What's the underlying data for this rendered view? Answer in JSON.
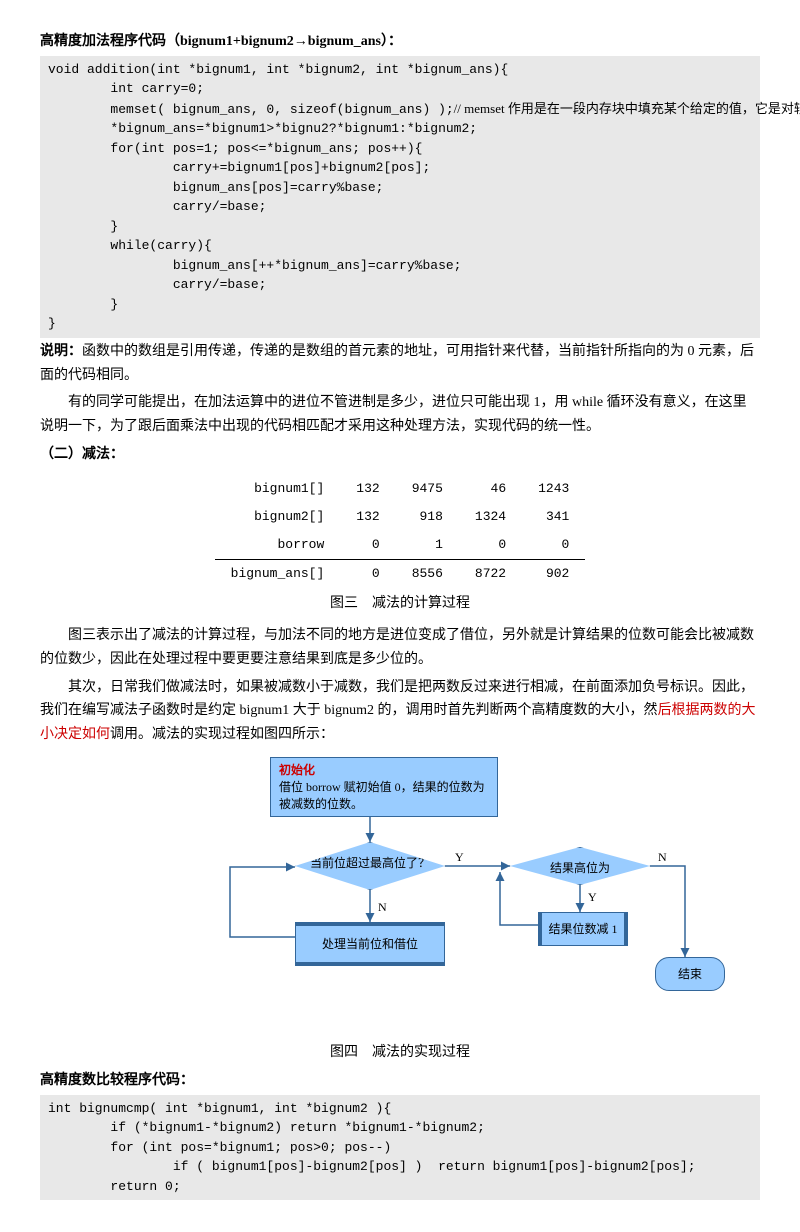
{
  "h1": "高精度加法程序代码（bignum1+bignum2→bignum_ans）：",
  "code1_l1": "void addition(int *bignum1, int *bignum2, int *bignum_ans){",
  "code1_l2": "        int carry=0;",
  "code1_l3": "        memset( bignum_ans, 0, sizeof(bignum_ans) );",
  "code1_l3_cmt": "// memset 作用是在一段内存块中填充某个给定的值，它是对较大的结构体或数组进行清零操作的一种最快方法。",
  "code1_l4": "        *bignum_ans=*bignum1>*bignu2?*bignum1:*bignum2;",
  "code1_l5": "        for(int pos=1; pos<=*bignum_ans; pos++){",
  "code1_l6": "                carry+=bignum1[pos]+bignum2[pos];",
  "code1_l7": "                bignum_ans[pos]=carry%base;",
  "code1_l8": "                carry/=base;",
  "code1_l9": "        }",
  "code1_l10": "        while(carry){",
  "code1_l11": "                bignum_ans[++*bignum_ans]=carry%base;",
  "code1_l12": "                carry/=base;",
  "code1_l13": "        }",
  "code1_l14": "}",
  "note_lbl": "说明：",
  "note_txt": "函数中的数组是引用传递，传递的是数组的首元素的地址，可用指针来代替，当前指针所指向的为 0 元素，后面的代码相同。",
  "p1": "有的同学可能提出，在加法运算中的进位不管进制是多少，进位只可能出现 1，用 while 循环没有意义，在这里说明一下，为了跟后面乘法中出现的代码相匹配才采用这种处理方法，实现代码的统一性。",
  "h2": "（二）减法：",
  "tbl": {
    "r1": [
      "bignum1[]",
      "132",
      "9475",
      "46",
      "1243"
    ],
    "r2": [
      "bignum2[]",
      "132",
      "918",
      "1324",
      "341"
    ],
    "r3": [
      "borrow",
      "0",
      "1",
      "0",
      "0"
    ],
    "r4": [
      "bignum_ans[]",
      "0",
      "8556",
      "8722",
      "902"
    ]
  },
  "cap3": "图三　减法的计算过程",
  "p2": "图三表示出了减法的计算过程，与加法不同的地方是进位变成了借位，另外就是计算结果的位数可能会比被减数的位数少，因此在处理过程中要更要注意结果到底是多少位的。",
  "p3a": "其次，日常我们做减法时，如果被减数小于减数，我们是把两数反过来进行相减，在前面添加负号标识。因此，我们在编写减法子函数时是约定 bignum1 大于 bignum2 的，调用时首先判断两个高精度数的大小，然",
  "p3b": "后根据两数的大小决定如何",
  "p3c": "调用。减法的实现过程如图四所示：",
  "flow": {
    "init_title": "初始化",
    "init_body": "借位 borrow 赋初始值 0，结果的位数为被减数的位数。",
    "d1": "当前位超过最高位了？",
    "d2": "结果高位为",
    "r1": "处理当前位和借位",
    "r2": "结果位数减 1",
    "end": "结束",
    "Y": "Y",
    "N": "N"
  },
  "cap4": "图四　减法的实现过程",
  "h3": "高精度数比较程序代码：",
  "code2_l1": "int bignumcmp( int *bignum1, int *bignum2 ){",
  "code2_l2": "        if (*bignum1-*bignum2) return *bignum1-*bignum2;",
  "code2_l3": "        for (int pos=*bignum1; pos>0; pos--)",
  "code2_l4": "                if ( bignum1[pos]-bignum2[pos] )  return bignum1[pos]-bignum2[pos];",
  "code2_l5": "        return 0;"
}
